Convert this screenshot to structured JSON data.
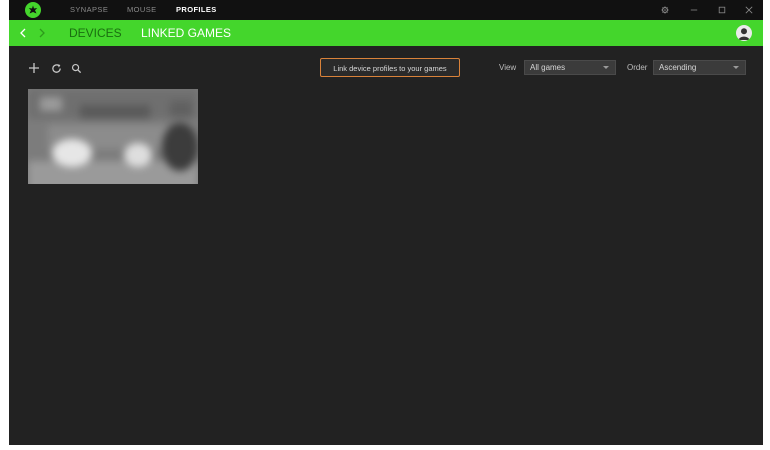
{
  "titlebar": {
    "tabs": [
      {
        "label": "SYNAPSE",
        "active": false
      },
      {
        "label": "MOUSE",
        "active": false
      },
      {
        "label": "PROFILES",
        "active": true
      }
    ],
    "controls": [
      "settings-icon",
      "minimize-icon",
      "maximize-icon",
      "close-icon"
    ]
  },
  "subbar": {
    "tabs": [
      {
        "label": "DEVICES",
        "active": false
      },
      {
        "label": "LINKED GAMES",
        "active": true
      }
    ]
  },
  "toolbar": {
    "link_button_label": "Link device profiles to your games",
    "view_label": "View",
    "view_value": "All games",
    "order_label": "Order",
    "order_value": "Ascending"
  },
  "games": [
    {
      "icon": "game-thumbnail"
    }
  ],
  "colors": {
    "accent": "#44d62c",
    "background": "#222222",
    "titlebar": "#111111",
    "link_button_border": "#d9823a"
  }
}
